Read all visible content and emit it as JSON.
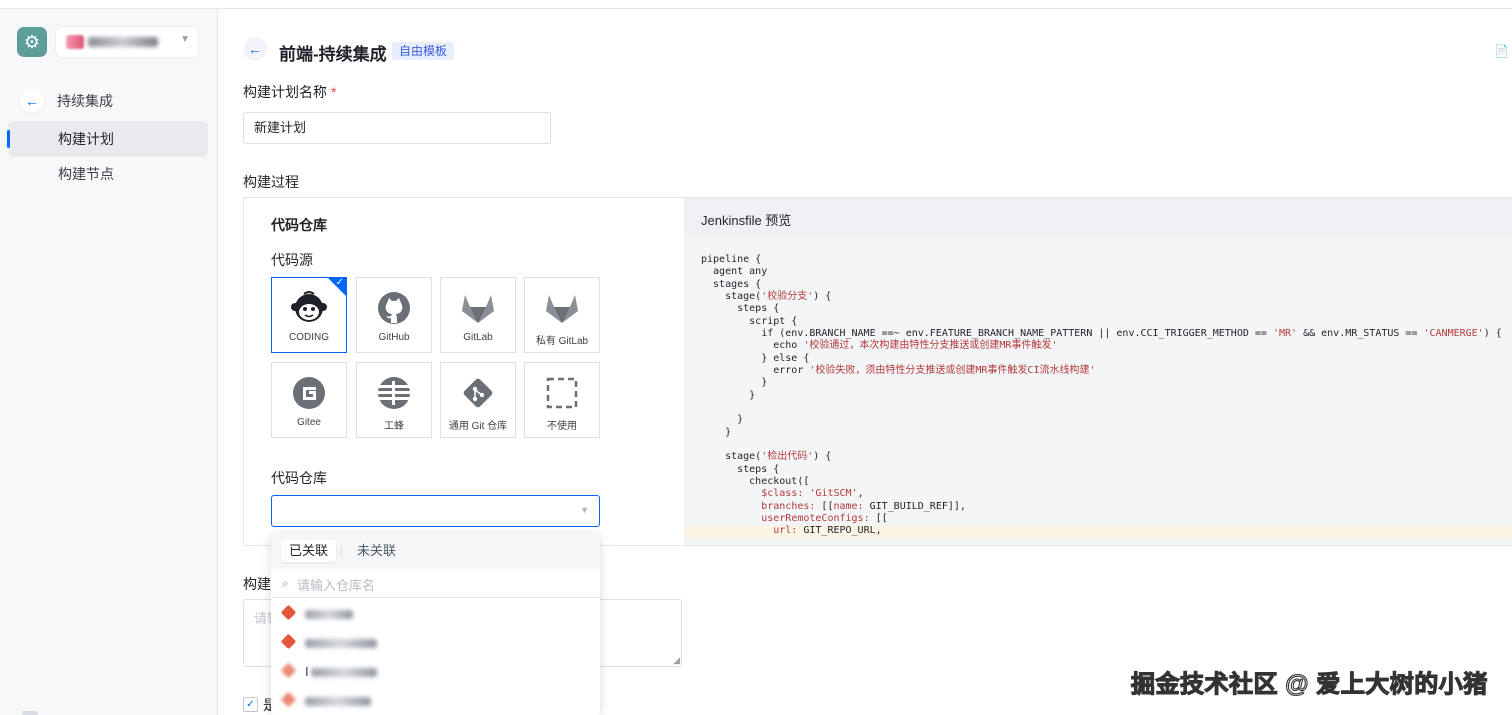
{
  "sidebar": {
    "back_label": "持续集成",
    "items": [
      {
        "label": "构建计划",
        "active": true
      },
      {
        "label": "构建节点",
        "active": false
      }
    ]
  },
  "header": {
    "title": "前端-持续集成",
    "tag": "自由模板",
    "doc_icon": "📄"
  },
  "form": {
    "plan_name_label": "构建计划名称",
    "required_mark": "*",
    "plan_name_value": "新建计划",
    "process_label": "构建过程",
    "desc_label_partial": "构建",
    "desc_placeholder_partial": "请输",
    "checkbox_label_partial": "是"
  },
  "repo": {
    "section_title": "代码仓库",
    "source_label": "代码源",
    "repo_label": "代码仓库",
    "sources": [
      {
        "label": "CODING",
        "icon": "coding-icon",
        "selected": true
      },
      {
        "label": "GitHub",
        "icon": "github-icon",
        "selected": false
      },
      {
        "label": "GitLab",
        "icon": "gitlab-icon",
        "selected": false
      },
      {
        "label": "私有 GitLab",
        "icon": "gitlab-private-icon",
        "selected": false
      },
      {
        "label": "Gitee",
        "icon": "gitee-icon",
        "selected": false
      },
      {
        "label": "工蜂",
        "icon": "gongfeng-icon",
        "selected": false
      },
      {
        "label": "通用 Git 仓库",
        "icon": "git-generic-icon",
        "selected": false
      },
      {
        "label": "不使用",
        "icon": "none-icon",
        "selected": false
      }
    ]
  },
  "dropdown": {
    "tab_linked": "已关联",
    "tab_unlinked": "未关联",
    "search_placeholder": "请输入仓库名",
    "item3_lead": "I"
  },
  "preview": {
    "title": "Jenkinsfile 预览"
  },
  "colors": {
    "accent": "#0066ff",
    "tag_bg": "#e8eefe",
    "required": "#f53f3f",
    "code_string": "#b33a3a"
  },
  "watermark": "掘金技术社区 @ 爱上大树的小猪"
}
